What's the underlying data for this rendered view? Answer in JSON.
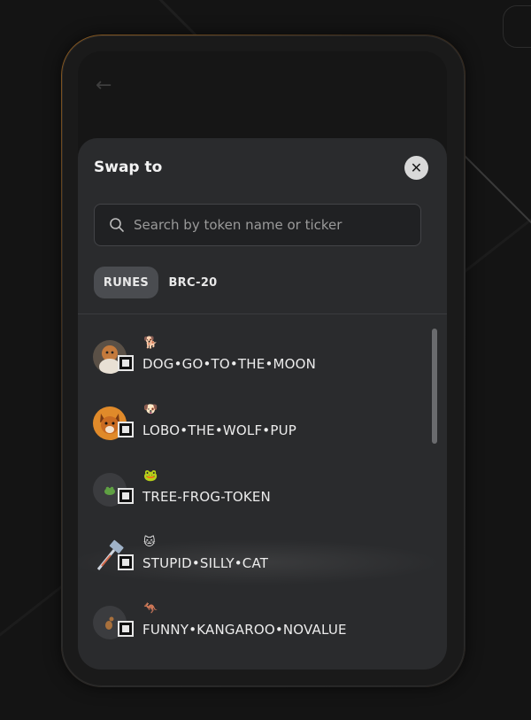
{
  "sheet": {
    "title": "Swap to",
    "close_icon": "close-icon",
    "back_icon": "back-arrow-icon"
  },
  "search": {
    "placeholder": "Search by token name or ticker",
    "icon": "search-icon"
  },
  "tabs": [
    {
      "label": "RUNES",
      "active": true
    },
    {
      "label": "BRC-20",
      "active": false
    }
  ],
  "tokens": [
    {
      "symbol": "🐕",
      "name": "DOG•GO•TO•THE•MOON",
      "avatar": "dog-avatar"
    },
    {
      "symbol": "🐶",
      "name": "LOBO•THE•WOLF•PUP",
      "avatar": "wolf-avatar"
    },
    {
      "symbol": "🐸",
      "name": "TREE-FROG-TOKEN",
      "avatar": "frog-avatar"
    },
    {
      "symbol": "🐱",
      "name": "STUPID•SILLY•CAT",
      "avatar": "hammer-avatar"
    },
    {
      "symbol": "🦘",
      "name": "FUNNY•KANGAROO•NOVALUE",
      "avatar": "kangaroo-avatar"
    }
  ],
  "colors": {
    "background": "#141414",
    "sheet": "#2a2b2d",
    "active_tab": "#4a4c50"
  }
}
